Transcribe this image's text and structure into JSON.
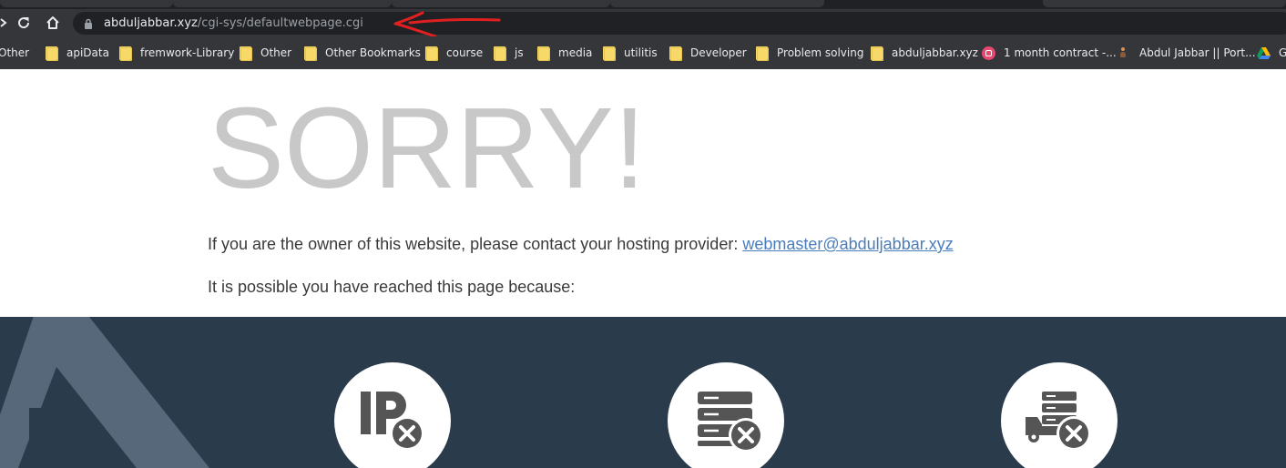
{
  "browser": {
    "url_host": "abduljabbar.xyz",
    "url_path": "/cgi-sys/defaultwebpage.cgi",
    "bookmarks": [
      {
        "label": "Other",
        "icon": "folder-icon"
      },
      {
        "label": "apiData",
        "icon": "folder-icon"
      },
      {
        "label": "fremwork-Library",
        "icon": "folder-icon"
      },
      {
        "label": "Other",
        "icon": "folder-icon"
      },
      {
        "label": "Other Bookmarks",
        "icon": "folder-icon"
      },
      {
        "label": "course",
        "icon": "folder-icon"
      },
      {
        "label": "js",
        "icon": "folder-icon"
      },
      {
        "label": "media",
        "icon": "folder-icon"
      },
      {
        "label": "utilitis",
        "icon": "folder-icon"
      },
      {
        "label": "Developer",
        "icon": "folder-icon"
      },
      {
        "label": "Problem solving",
        "icon": "folder-icon"
      },
      {
        "label": "abduljabbar.xyz",
        "icon": "folder-icon"
      },
      {
        "label": "1 month contract -...",
        "icon": "site-favicon-icon"
      },
      {
        "label": "Abdul Jabbar || Port...",
        "icon": "portfolio-favicon-icon"
      },
      {
        "label": "G",
        "icon": "google-drive-icon"
      }
    ],
    "colors": {
      "chrome_bg": "#35363a",
      "omnibox_bg": "#202124",
      "annotation_arrow": "#e02020"
    }
  },
  "page": {
    "heading": "SORRY!",
    "owner_text": "If you are the owner of this website, please contact your hosting provider: ",
    "owner_email": "webmaster@abduljabbar.xyz",
    "reason_intro": "It is possible you have reached this page because:",
    "reason_icons": [
      "ip-error-icon",
      "server-error-icon",
      "server-moved-icon"
    ],
    "colors": {
      "heading": "#c8c8c8",
      "link": "#4a7dbc",
      "reasons_bg": "#2a3b4c"
    }
  }
}
